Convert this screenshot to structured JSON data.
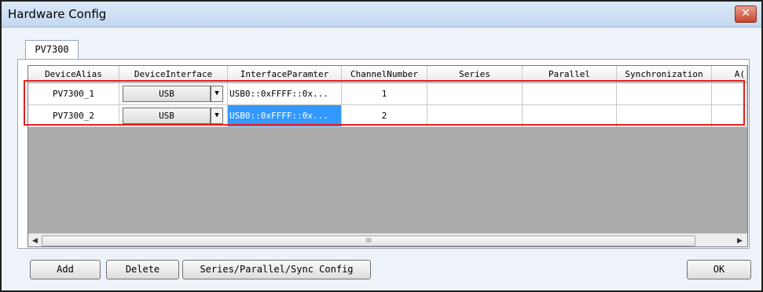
{
  "window": {
    "title": "Hardware Config",
    "close_glyph": "✕"
  },
  "tabs": [
    {
      "label": "PV7300"
    }
  ],
  "grid": {
    "columns": [
      "DeviceAlias",
      "DeviceInterface",
      "InterfaceParamter",
      "ChannelNumber",
      "Series",
      "Parallel",
      "Synchronization",
      "A("
    ],
    "rows": [
      {
        "alias": "PV7300_1",
        "interface": "USB",
        "param": "USB0::0xFFFF::0x...",
        "channel": "1",
        "series": "",
        "parallel": "",
        "sync": "",
        "extra": ""
      },
      {
        "alias": "PV7300_2",
        "interface": "USB",
        "param": "USB0::0xFFFF::0x...",
        "channel": "2",
        "series": "",
        "parallel": "",
        "sync": "",
        "extra": ""
      }
    ],
    "dropdown_glyph": "▼",
    "scroll_left_glyph": "◀",
    "scroll_right_glyph": "▶",
    "scroll_thumb_grip": "III"
  },
  "buttons": {
    "add": "Add",
    "delete": "Delete",
    "config": "Series/Parallel/Sync Config",
    "ok": "OK"
  }
}
